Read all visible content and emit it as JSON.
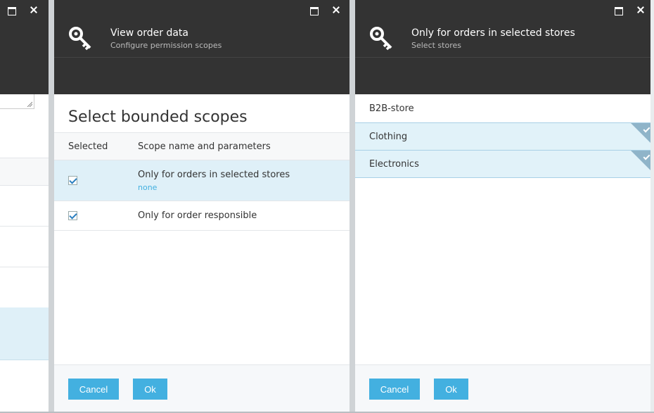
{
  "blade_middle": {
    "title": "View order data",
    "subtitle": "Configure permission scopes",
    "section_title": "Select bounded scopes",
    "columns": [
      "Selected",
      "Scope name and parameters"
    ],
    "rows": [
      {
        "name": "Only for orders in selected stores",
        "param": "none",
        "checked": true,
        "selected": true
      },
      {
        "name": "Only for order responsible",
        "param": "",
        "checked": true,
        "selected": false
      }
    ],
    "cancel_label": "Cancel",
    "ok_label": "Ok"
  },
  "blade_right": {
    "title": "Only for orders in selected stores",
    "subtitle": "Select stores",
    "stores": [
      {
        "name": "B2B-store",
        "selected": false
      },
      {
        "name": "Clothing",
        "selected": true
      },
      {
        "name": "Electronics",
        "selected": true
      }
    ],
    "cancel_label": "Cancel",
    "ok_label": "Ok"
  },
  "colors": {
    "accent": "#43b0e0",
    "header_bg": "#333333",
    "selected_row_bg": "#dff0f8"
  }
}
